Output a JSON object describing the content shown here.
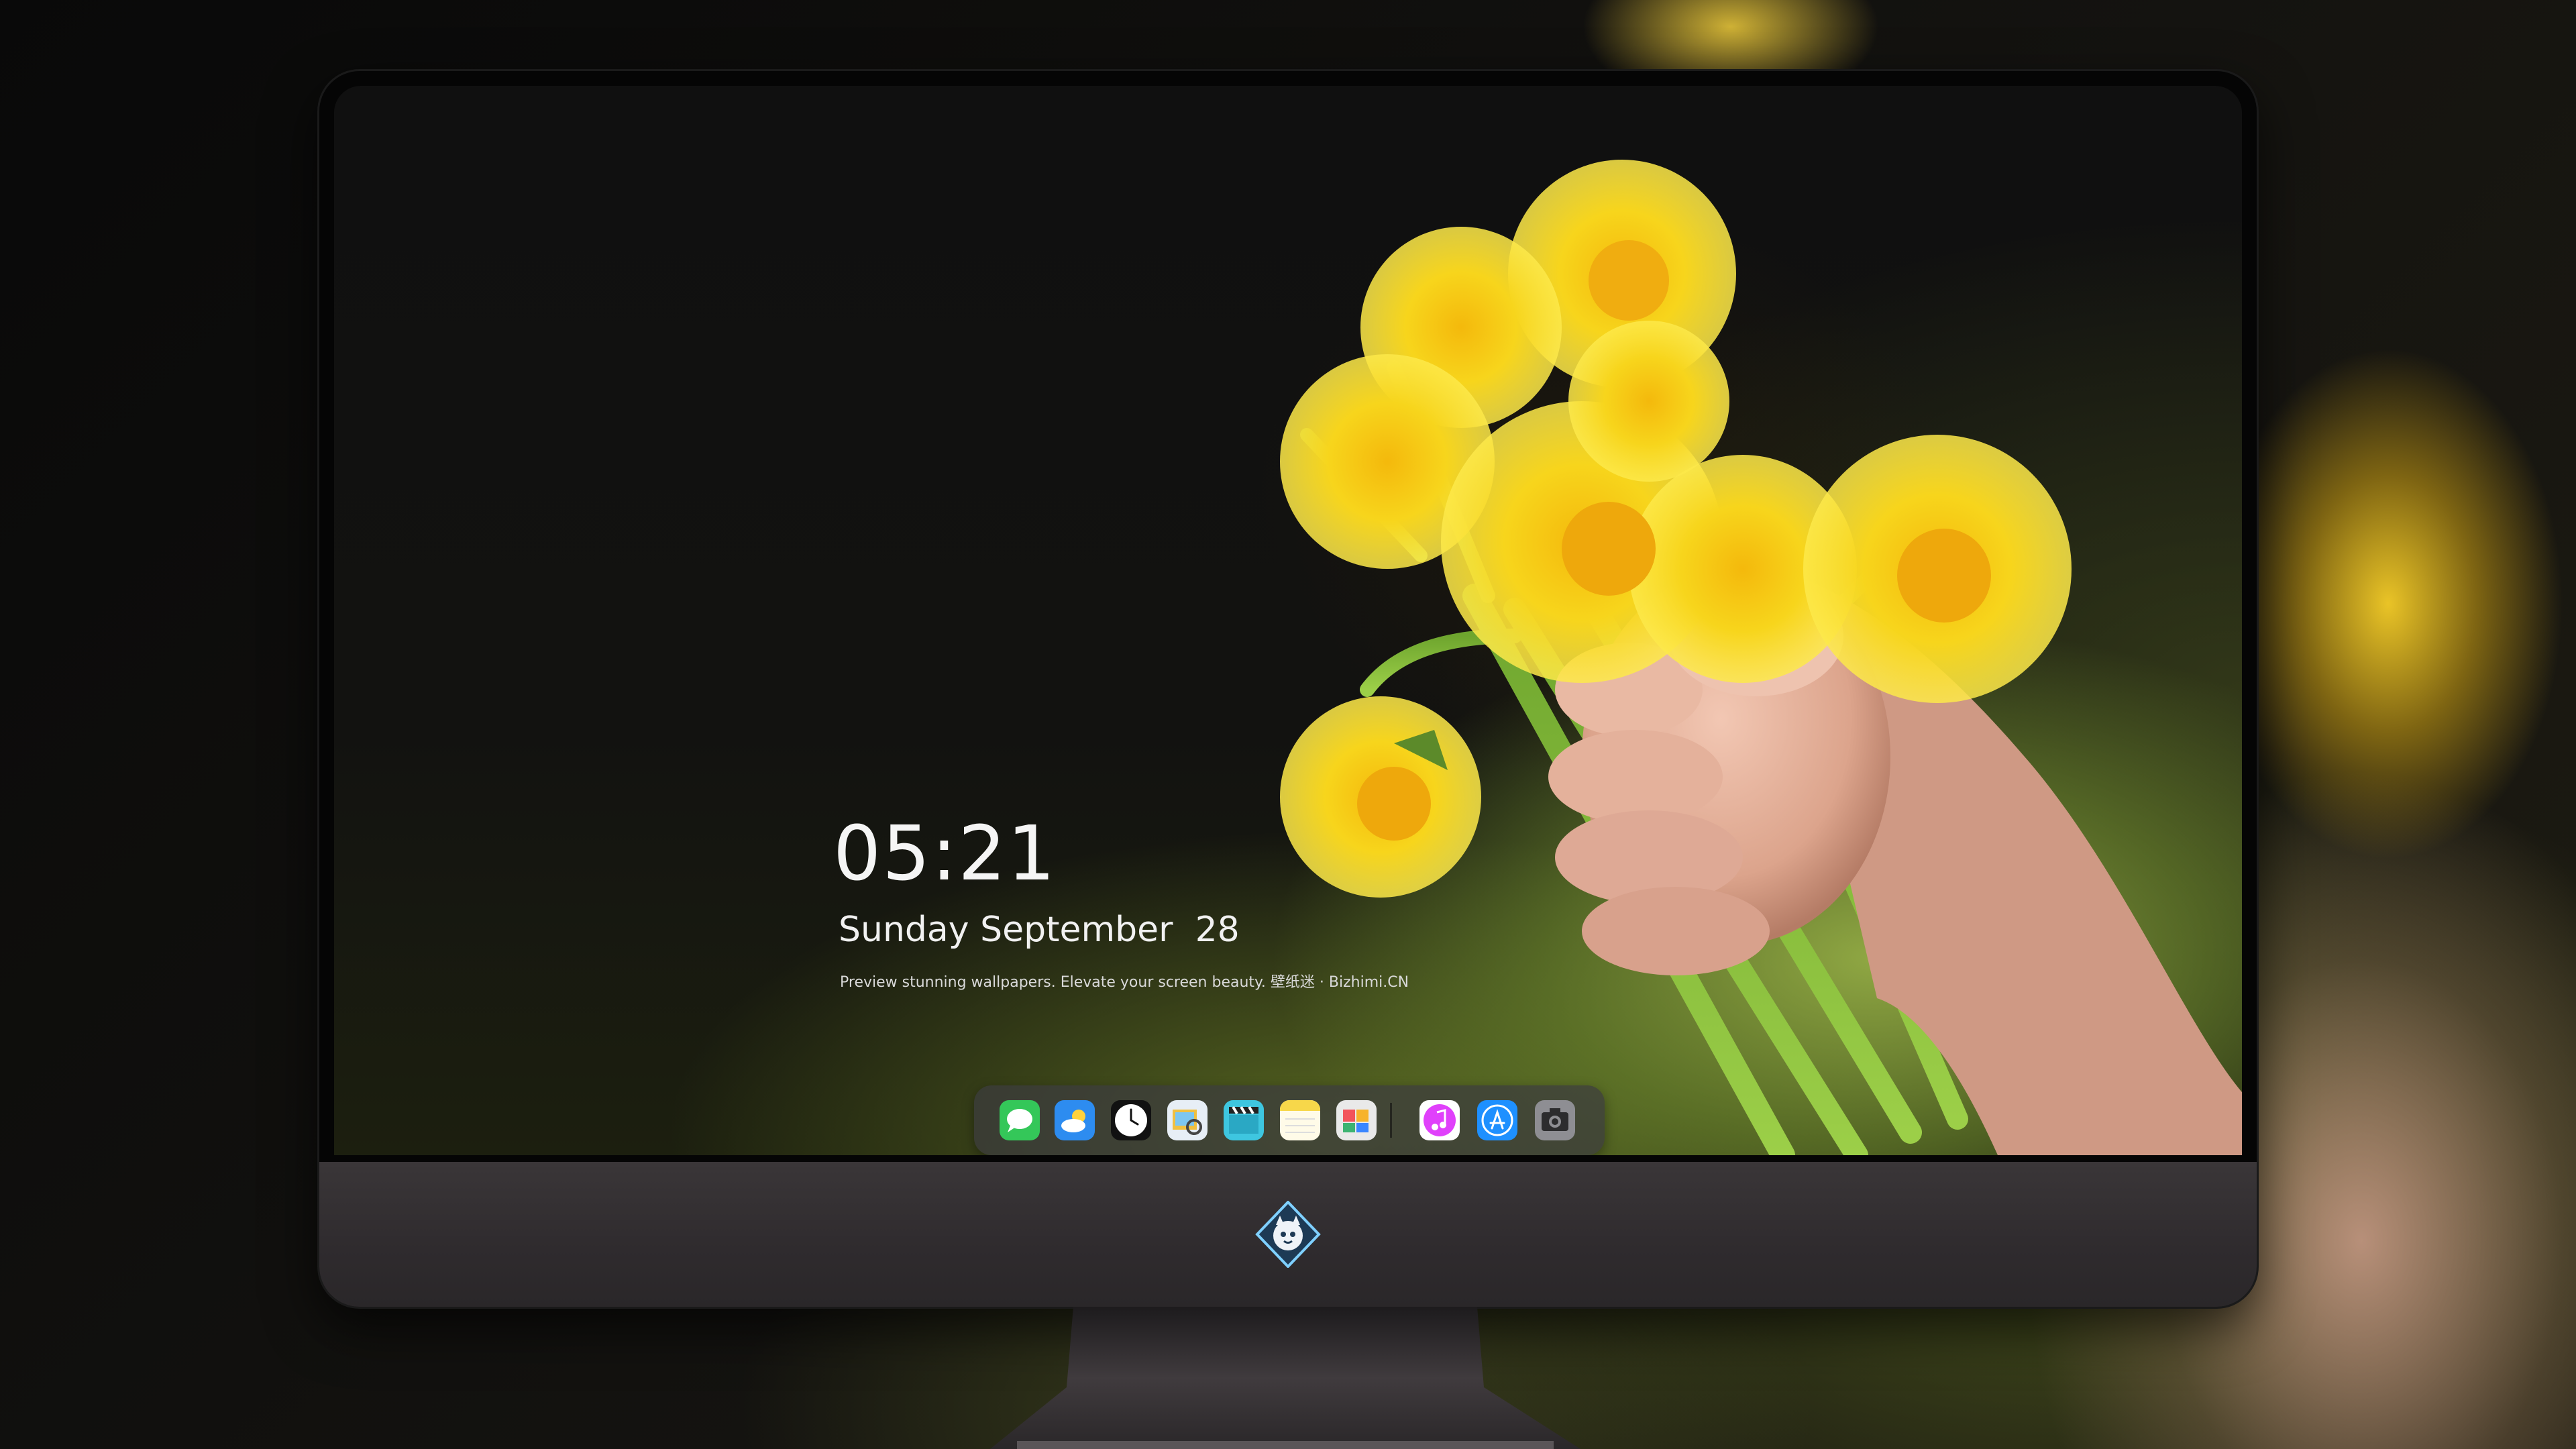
{
  "lock_screen": {
    "time": "05:21",
    "date": "Sunday September  28",
    "tagline": "Preview stunning wallpapers. Elevate your screen beauty. 壁纸迷 · Bizhimi.CN"
  },
  "dock": {
    "apps": [
      {
        "name": "messages",
        "icon": "messages-icon",
        "color": "#34c759"
      },
      {
        "name": "weather",
        "icon": "weather-icon",
        "color": "#2d8cf0"
      },
      {
        "name": "clock",
        "icon": "clock-icon",
        "color": "#111111"
      },
      {
        "name": "preview",
        "icon": "preview-icon",
        "color": "#f0c040"
      },
      {
        "name": "clips",
        "icon": "clapperboard-icon",
        "color": "#3ec6e0"
      },
      {
        "name": "notes",
        "icon": "notes-icon",
        "color": "#f7d74a"
      },
      {
        "name": "photo-booth",
        "icon": "photos-icon",
        "color": "#e9e9e9"
      },
      {
        "name": "music",
        "icon": "music-icon",
        "color": "#e040fb"
      },
      {
        "name": "app-store",
        "icon": "app-store-icon",
        "color": "#1e90ff"
      },
      {
        "name": "camera",
        "icon": "camera-icon",
        "color": "#8e8e93"
      }
    ]
  },
  "monitor": {
    "logo_icon": "fox-logo-icon",
    "colors": {
      "bezel": "#050505",
      "chin": "#332f32",
      "stand": "#2d2a2c"
    }
  },
  "wallpaper": {
    "subject": "dandelion-bouquet-icon",
    "accent": "#f7d51c"
  }
}
